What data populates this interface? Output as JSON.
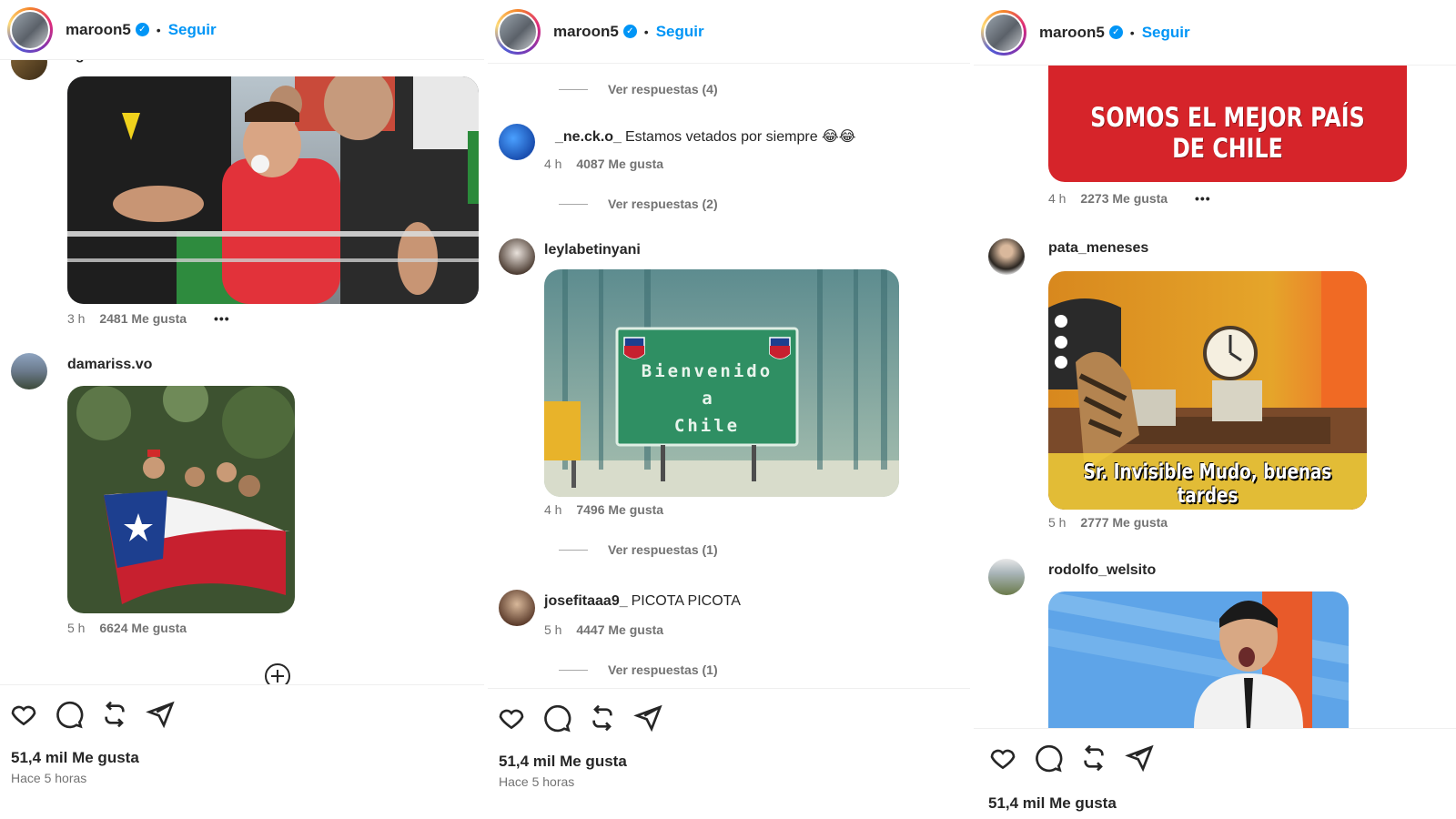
{
  "panels": [
    {
      "header": {
        "username": "maroon5",
        "follow": "Seguir"
      },
      "partial_user": "agusmiles",
      "comments": [
        {
          "meta": {
            "time": "3 h",
            "likes": "2481 Me gusta",
            "more": "•••"
          }
        },
        {
          "username": "damariss.vo",
          "meta": {
            "time": "5 h",
            "likes": "6624 Me gusta"
          }
        }
      ],
      "footer": {
        "likes": "51,4 mil Me gusta",
        "time": "Hace 5 horas"
      }
    },
    {
      "header": {
        "username": "maroon5",
        "follow": "Seguir"
      },
      "replies": [
        "Ver respuestas (4)",
        "Ver respuestas (2)",
        "Ver respuestas (1)",
        "Ver respuestas (1)"
      ],
      "comments": [
        {
          "username": "_ne.ck.o_",
          "text": "Estamos vetados por siempre 😂😂",
          "meta": {
            "time": "4 h",
            "likes": "4087 Me gusta"
          }
        },
        {
          "username": "leylabetinyani",
          "image_text": [
            "Bienvenido",
            "a",
            "Chile"
          ],
          "meta": {
            "time": "4 h",
            "likes": "7496 Me gusta"
          }
        },
        {
          "username": "josefitaaa9_",
          "text": "PICOTA PICOTA",
          "meta": {
            "time": "5 h",
            "likes": "4447 Me gusta"
          }
        }
      ],
      "footer": {
        "likes": "51,4 mil Me gusta",
        "time": "Hace 5 horas"
      }
    },
    {
      "header": {
        "username": "maroon5",
        "follow": "Seguir"
      },
      "comments": [
        {
          "image_text": "SOMOS EL MEJOR PAÍS DE CHILE",
          "meta": {
            "time": "4 h",
            "likes": "2273 Me gusta",
            "more": "•••"
          }
        },
        {
          "username": "pata_meneses",
          "image_text": "Sr. Invisible Mudo, buenas tardes",
          "meta": {
            "time": "5 h",
            "likes": "2777 Me gusta"
          }
        },
        {
          "username": "rodolfo_welsito"
        }
      ],
      "footer": {
        "likes": "51,4 mil Me gusta"
      }
    }
  ],
  "colors": {
    "link": "#0095f6",
    "text": "#262626",
    "muted": "#737373"
  },
  "icons": [
    "heart-icon",
    "comment-icon",
    "repost-icon",
    "share-icon",
    "verified-icon",
    "add-comment-icon"
  ]
}
